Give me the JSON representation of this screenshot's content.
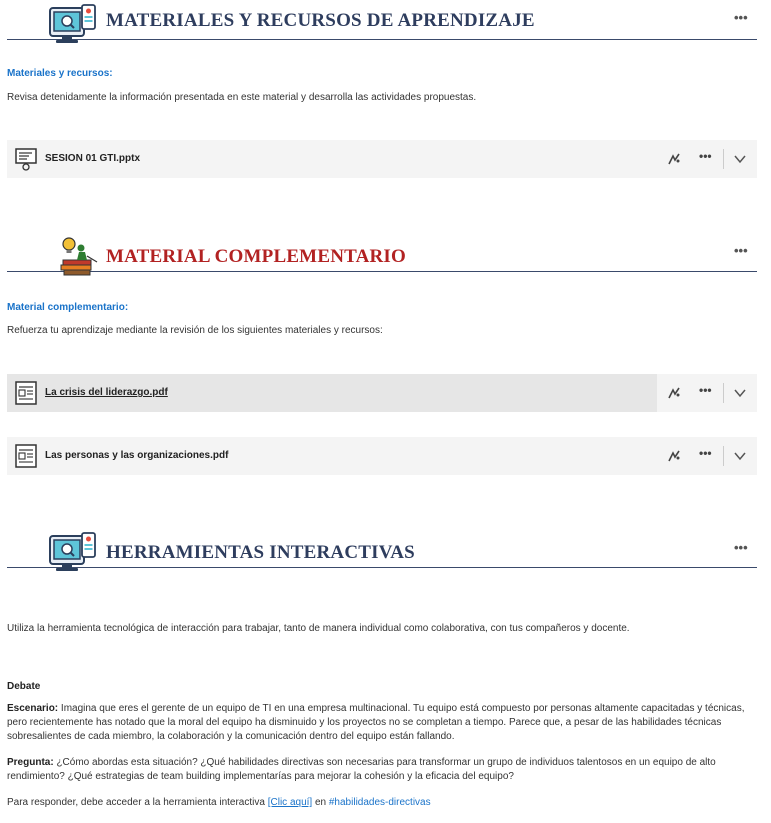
{
  "sections": [
    {
      "title": "MATERIALES Y RECURSOS DE APRENDIZAJE",
      "title_color": "#2e3d5e",
      "icon": "computer-monitor-icon",
      "options_label": "•••",
      "subtitle": "Materiales y recursos:",
      "description": "Revisa detenidamente la información presentada en este material y desarrolla las actividades propuestas.",
      "files": [
        {
          "name": "SESION 01 GTI.pptx",
          "icon": "presentation-icon"
        }
      ]
    },
    {
      "title": "MATERIAL COMPLEMENTARIO",
      "title_color": "#b22222",
      "icon": "books-lightbulb-icon",
      "options_label": "•••",
      "subtitle": "Material complementario:",
      "description": "Refuerza tu aprendizaje mediante la revisión de los siguientes materiales y recursos:",
      "files": [
        {
          "name": "La crisis del liderazgo.pdf",
          "icon": "document-icon"
        },
        {
          "name": "Las personas y las organizaciones.pdf",
          "icon": "document-icon"
        }
      ]
    },
    {
      "title": "HERRAMIENTAS INTERACTIVAS",
      "title_color": "#2e3d5e",
      "icon": "computer-monitor-icon",
      "options_label": "•••",
      "description": "Utiliza la herramienta tecnológica de interacción para trabajar, tanto de manera individual como colaborativa, con tus compañeros y docente.",
      "debate_heading": "Debate",
      "scenario_label": "Escenario:",
      "scenario_text": " Imagina que eres el gerente de un equipo de TI en una empresa multinacional. Tu equipo está compuesto por personas altamente capacitadas y técnicas, pero recientemente has notado que la moral del equipo ha disminuido y los proyectos no se completan a tiempo. Parece que, a pesar de las habilidades técnicas sobresalientes de cada miembro, la colaboración y la comunicación dentro del equipo están fallando.",
      "question_label": "Pregunta:",
      "question_text": " ¿Cómo abordas esta situación? ¿Qué habilidades directivas son necesarias para transformar un grupo de individuos talentosos en un equipo de alto rendimiento? ¿Qué estrategias de team building implementarías para mejorar la cohesión y la eficacia del equipo?",
      "respond_prefix": "Para responder, debe acceder a la herramienta interactiva ",
      "respond_link": "[Clic aquí]",
      "respond_mid": " en ",
      "respond_tag": "#habilidades-directivas"
    }
  ],
  "file_tools": {
    "options_label": "•••"
  }
}
